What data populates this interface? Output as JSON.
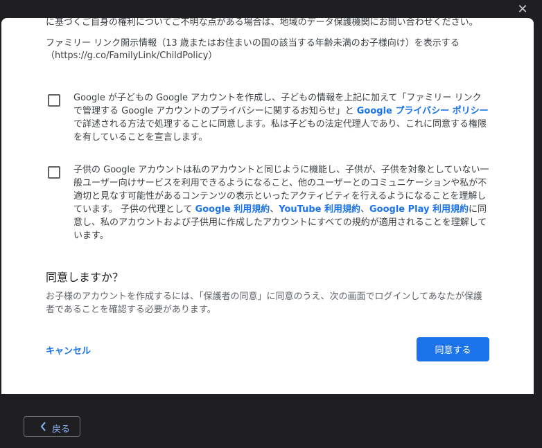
{
  "window": {
    "close_glyph": "✕"
  },
  "dialog": {
    "top_text": "に基づくご自身の権利についてご不明な点がある場合は、地域のデータ保護機関にお問い合わせください。",
    "familylink_text": "ファミリー リンク開示情報（13 歳またはお住まいの国の該当する年齢未満のお子様向け）を表示する",
    "familylink_url": "（https://g.co/FamilyLink/ChildPolicy）",
    "consent1": {
      "text_before": "Google が子どもの Google アカウントを作成し、子どもの情報を上記に加えて「ファミリー リンクで管理する Google アカウントのプライバシーに関するお知らせ」と ",
      "link": "Google プライバシー ポリシー",
      "text_after": "で詳述される方法で処理することに同意します。私は子どもの法定代理人であり、これに同意する権限を有していることを宣言します。",
      "checked": false
    },
    "consent2": {
      "text_before": "子供の Google アカウントは私のアカウントと同じように機能し、子供が、子供を対象としていない一般ユーザー向けサービスを利用できるようになること、他のユーザーとのコミュニケーションや私が不適切と見なす可能性があるコンテンツの表示といったアクティビティを行えるようになることを理解しています。 子供の代理として ",
      "link1": "Google 利用規約",
      "sep1": "、",
      "link2": "YouTube 利用規約",
      "sep2": "、",
      "link3": "Google Play 利用規約",
      "text_after": "に同意し、私のアカウントおよび子供用に作成したアカウントにすべての規約が適用されることを理解しています。",
      "checked": false
    },
    "agree_title": "同意しますか？",
    "agree_desc": "お子様のアカウントを作成するには、「保護者の同意」に同意のうえ、次の画面でログインしてあなたが保護者であることを確認する必要があります。",
    "cancel_label": "キャンセル",
    "agree_label": "同意する"
  },
  "footer": {
    "back_label": "戻る"
  },
  "colors": {
    "accent": "#1a73e8",
    "backdrop": "#1f1f21",
    "dialog_bg": "#ffffff",
    "back_text": "#8ab4f8"
  }
}
